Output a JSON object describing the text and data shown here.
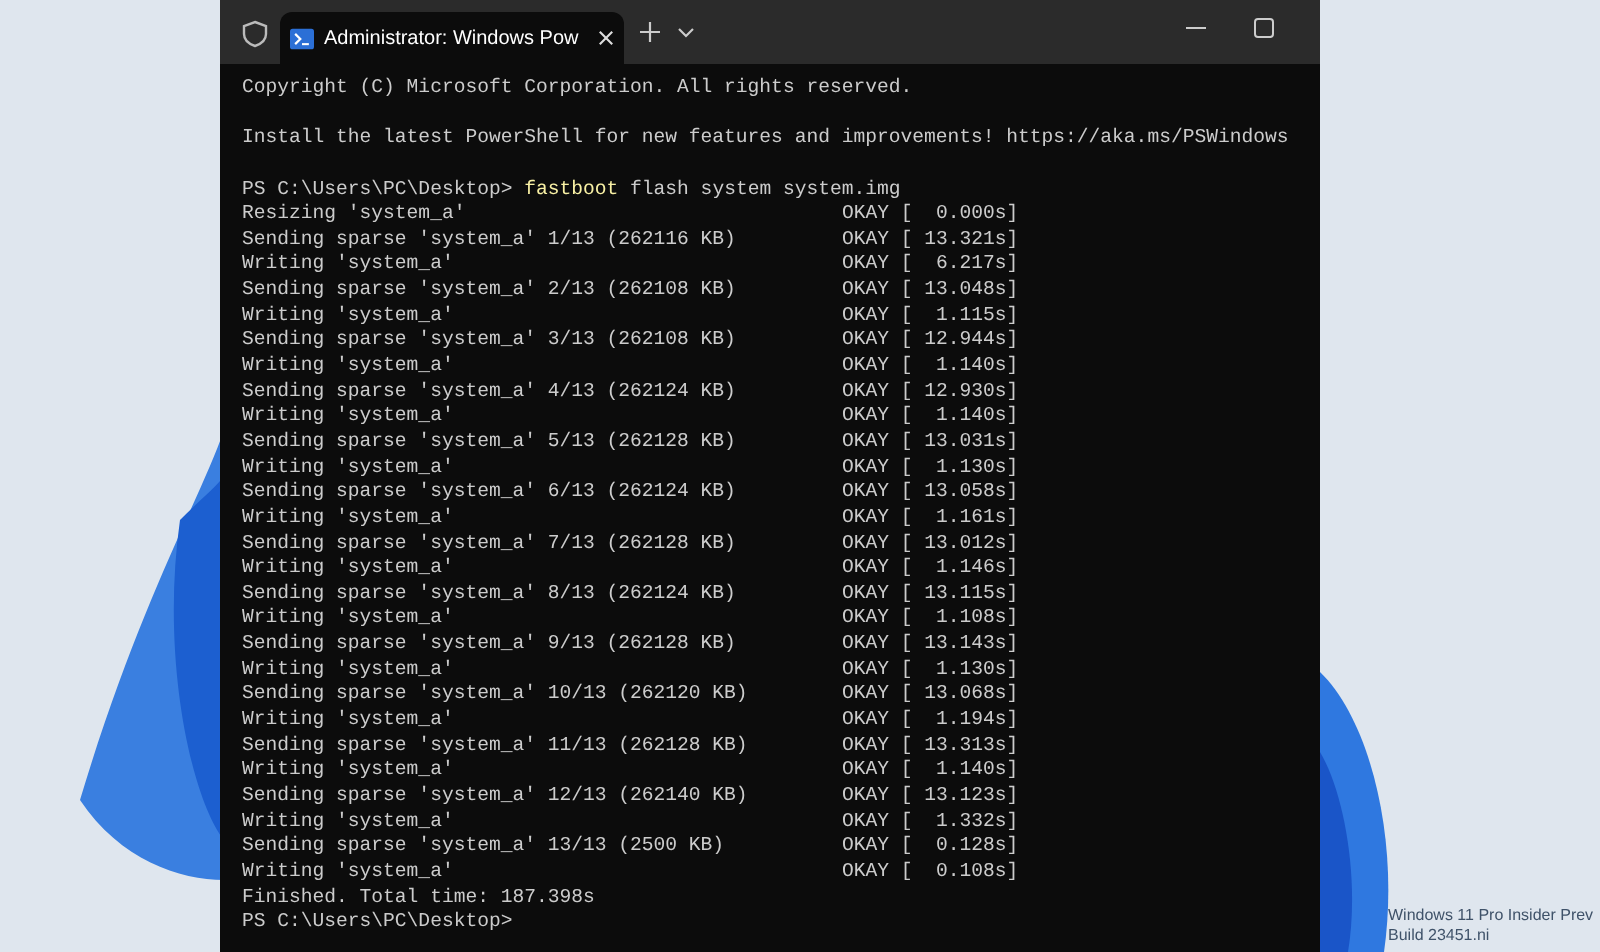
{
  "window": {
    "tab": {
      "label": "Administrator: Windows Pow",
      "selected": true
    }
  },
  "terminal": {
    "lines": [
      {
        "kind": "text",
        "text": "Copyright (C) Microsoft Corporation. All rights reserved."
      },
      {
        "kind": "blank"
      },
      {
        "kind": "text",
        "text": "Install the latest PowerShell for new features and improvements! https://aka.ms/PSWindows"
      },
      {
        "kind": "blank"
      },
      {
        "kind": "command",
        "prompt": "PS C:\\Users\\PC\\Desktop>",
        "command": "fastboot",
        "args": "flash system system.img"
      },
      {
        "kind": "step",
        "text": "Resizing 'system_a'",
        "result": "OKAY [  0.000s]"
      },
      {
        "kind": "step",
        "text": "Sending sparse 'system_a' 1/13 (262116 KB)",
        "result": "OKAY [ 13.321s]"
      },
      {
        "kind": "step",
        "text": "Writing 'system_a'",
        "result": "OKAY [  6.217s]"
      },
      {
        "kind": "step",
        "text": "Sending sparse 'system_a' 2/13 (262108 KB)",
        "result": "OKAY [ 13.048s]"
      },
      {
        "kind": "step",
        "text": "Writing 'system_a'",
        "result": "OKAY [  1.115s]"
      },
      {
        "kind": "step",
        "text": "Sending sparse 'system_a' 3/13 (262108 KB)",
        "result": "OKAY [ 12.944s]"
      },
      {
        "kind": "step",
        "text": "Writing 'system_a'",
        "result": "OKAY [  1.140s]"
      },
      {
        "kind": "step",
        "text": "Sending sparse 'system_a' 4/13 (262124 KB)",
        "result": "OKAY [ 12.930s]"
      },
      {
        "kind": "step",
        "text": "Writing 'system_a'",
        "result": "OKAY [  1.140s]"
      },
      {
        "kind": "step",
        "text": "Sending sparse 'system_a' 5/13 (262128 KB)",
        "result": "OKAY [ 13.031s]"
      },
      {
        "kind": "step",
        "text": "Writing 'system_a'",
        "result": "OKAY [  1.130s]"
      },
      {
        "kind": "step",
        "text": "Sending sparse 'system_a' 6/13 (262124 KB)",
        "result": "OKAY [ 13.058s]"
      },
      {
        "kind": "step",
        "text": "Writing 'system_a'",
        "result": "OKAY [  1.161s]"
      },
      {
        "kind": "step",
        "text": "Sending sparse 'system_a' 7/13 (262128 KB)",
        "result": "OKAY [ 13.012s]"
      },
      {
        "kind": "step",
        "text": "Writing 'system_a'",
        "result": "OKAY [  1.146s]"
      },
      {
        "kind": "step",
        "text": "Sending sparse 'system_a' 8/13 (262124 KB)",
        "result": "OKAY [ 13.115s]"
      },
      {
        "kind": "step",
        "text": "Writing 'system_a'",
        "result": "OKAY [  1.108s]"
      },
      {
        "kind": "step",
        "text": "Sending sparse 'system_a' 9/13 (262128 KB)",
        "result": "OKAY [ 13.143s]"
      },
      {
        "kind": "step",
        "text": "Writing 'system_a'",
        "result": "OKAY [  1.130s]"
      },
      {
        "kind": "step",
        "text": "Sending sparse 'system_a' 10/13 (262120 KB)",
        "result": "OKAY [ 13.068s]"
      },
      {
        "kind": "step",
        "text": "Writing 'system_a'",
        "result": "OKAY [  1.194s]"
      },
      {
        "kind": "step",
        "text": "Sending sparse 'system_a' 11/13 (262128 KB)",
        "result": "OKAY [ 13.313s]"
      },
      {
        "kind": "step",
        "text": "Writing 'system_a'",
        "result": "OKAY [  1.140s]"
      },
      {
        "kind": "step",
        "text": "Sending sparse 'system_a' 12/13 (262140 KB)",
        "result": "OKAY [ 13.123s]"
      },
      {
        "kind": "step",
        "text": "Writing 'system_a'",
        "result": "OKAY [  1.332s]"
      },
      {
        "kind": "step",
        "text": "Sending sparse 'system_a' 13/13 (2500 KB)",
        "result": "OKAY [  0.128s]"
      },
      {
        "kind": "step",
        "text": "Writing 'system_a'",
        "result": "OKAY [  0.108s]"
      },
      {
        "kind": "text",
        "text": "Finished. Total time: 187.398s"
      },
      {
        "kind": "prompt",
        "prompt": "PS C:\\Users\\PC\\Desktop>"
      }
    ]
  },
  "desktop": {
    "edition_lines": [
      "Windows 11 Pro Insider Prev",
      "Build 23451.ni"
    ]
  }
}
